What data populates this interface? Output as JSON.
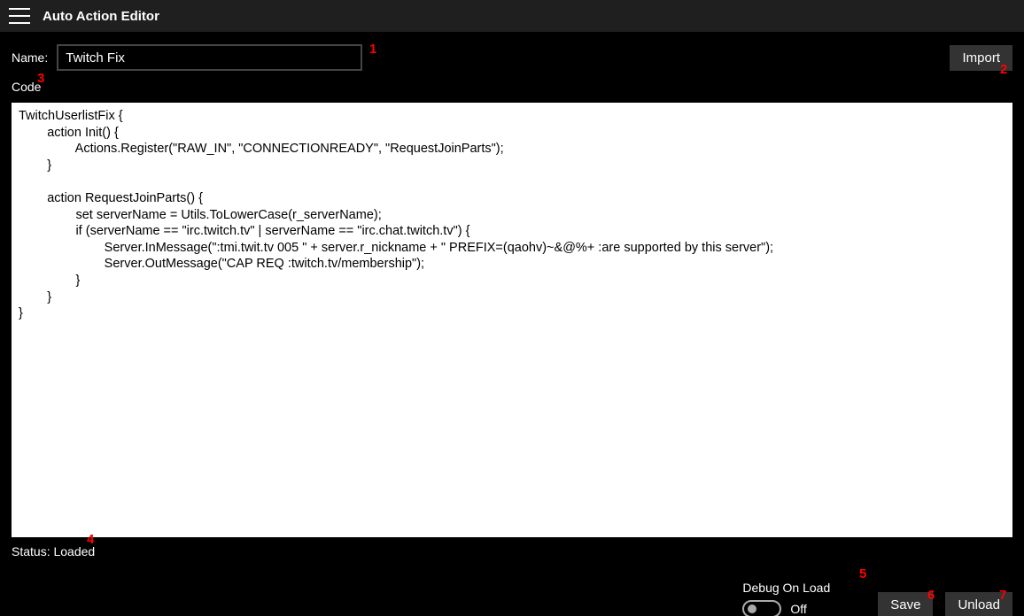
{
  "titlebar": {
    "title": "Auto Action Editor"
  },
  "form": {
    "name_label": "Name:",
    "name_value": "Twitch Fix",
    "import_label": "Import",
    "code_label": "Code"
  },
  "code": "TwitchUserlistFix {\n        action Init() {\n                Actions.Register(\"RAW_IN\", \"CONNECTIONREADY\", \"RequestJoinParts\");\n        }\n\n        action RequestJoinParts() {\n                set serverName = Utils.ToLowerCase(r_serverName);\n                if (serverName == \"irc.twitch.tv\" | serverName == \"irc.chat.twitch.tv\") {\n                        Server.InMessage(\":tmi.twit.tv 005 \" + server.r_nickname + \" PREFIX=(qaohv)~&@%+ :are supported by this server\");\n                        Server.OutMessage(\"CAP REQ :twitch.tv/membership\");\n                }\n        }\n}",
  "status": {
    "text": "Status: Loaded"
  },
  "debug": {
    "label": "Debug On Load",
    "state": "Off"
  },
  "buttons": {
    "save": "Save",
    "unload": "Unload"
  },
  "annotations": {
    "a1": "1",
    "a2": "2",
    "a3": "3",
    "a4": "4",
    "a5": "5",
    "a6": "6",
    "a7": "7"
  }
}
